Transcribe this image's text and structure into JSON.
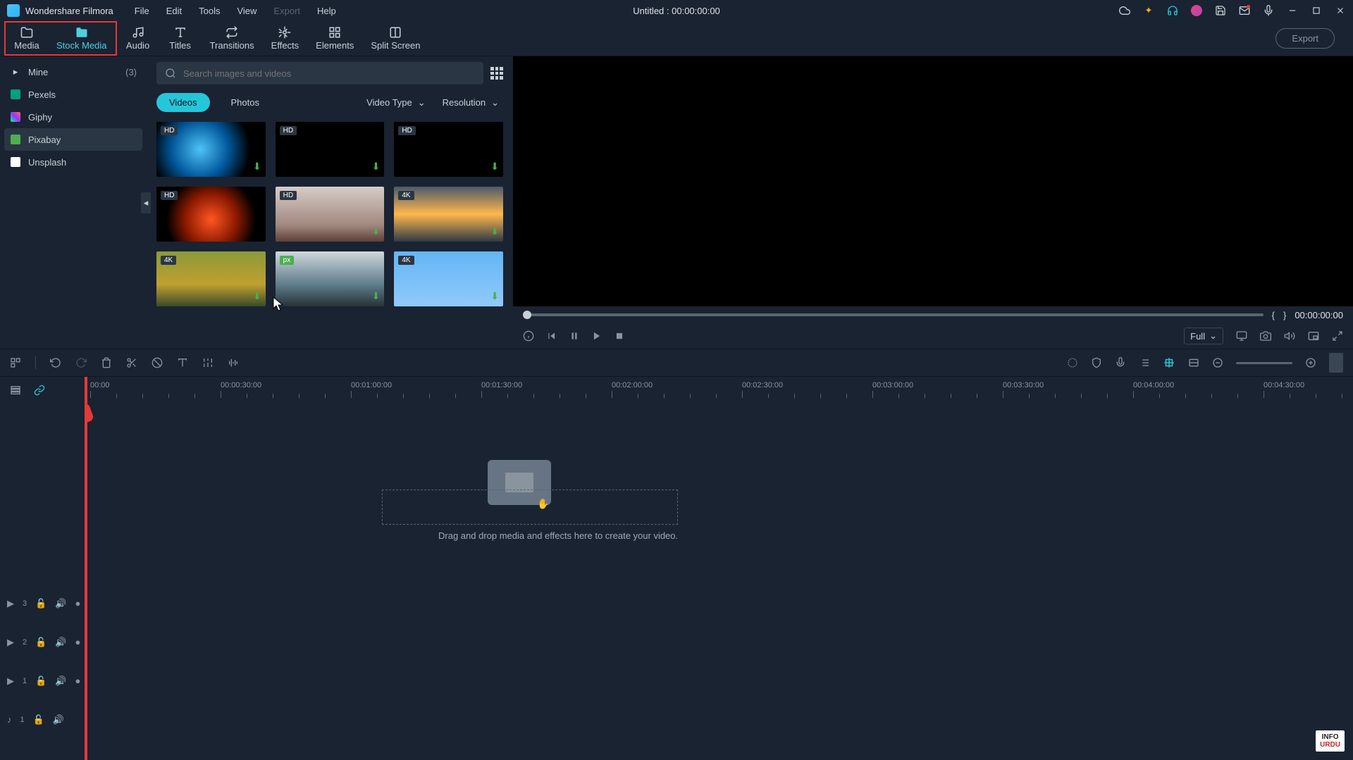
{
  "app_name": "Wondershare Filmora",
  "menu": {
    "file": "File",
    "edit": "Edit",
    "tools": "Tools",
    "view": "View",
    "export": "Export",
    "help": "Help"
  },
  "title": "Untitled : 00:00:00:00",
  "ribbon": {
    "media": "Media",
    "stock_media": "Stock Media",
    "audio": "Audio",
    "titles": "Titles",
    "transitions": "Transitions",
    "effects": "Effects",
    "elements": "Elements",
    "split_screen": "Split Screen",
    "export": "Export"
  },
  "sidebar": {
    "mine": "Mine",
    "mine_count": "(3)",
    "pexels": "Pexels",
    "giphy": "Giphy",
    "pixabay": "Pixabay",
    "unsplash": "Unsplash"
  },
  "search": {
    "placeholder": "Search images and videos"
  },
  "filters": {
    "videos": "Videos",
    "photos": "Photos",
    "video_type": "Video Type",
    "resolution": "Resolution"
  },
  "thumbs": [
    {
      "badge": "HD"
    },
    {
      "badge": "HD"
    },
    {
      "badge": "HD"
    },
    {
      "badge": "HD"
    },
    {
      "badge": "HD"
    },
    {
      "badge": "4K"
    },
    {
      "badge": "4K"
    },
    {
      "badge": "px"
    },
    {
      "badge": "4K"
    }
  ],
  "preview": {
    "mark_in": "{",
    "mark_out": "}",
    "timecode": "00:00:00:00",
    "quality": "Full"
  },
  "timeline": {
    "marks": [
      "00:00",
      "00:00:30:00",
      "00:01:00:00",
      "00:01:30:00",
      "00:02:00:00",
      "00:02:30:00",
      "00:03:00:00",
      "00:03:30:00",
      "00:04:00:00",
      "00:04:30:00"
    ],
    "drop_text": "Drag and drop media and effects here to create your video.",
    "tracks": {
      "v3": "3",
      "v2": "2",
      "v1": "1",
      "a1": "1"
    }
  },
  "info_badge": {
    "l1": "INFO",
    "l2": "URDU"
  }
}
